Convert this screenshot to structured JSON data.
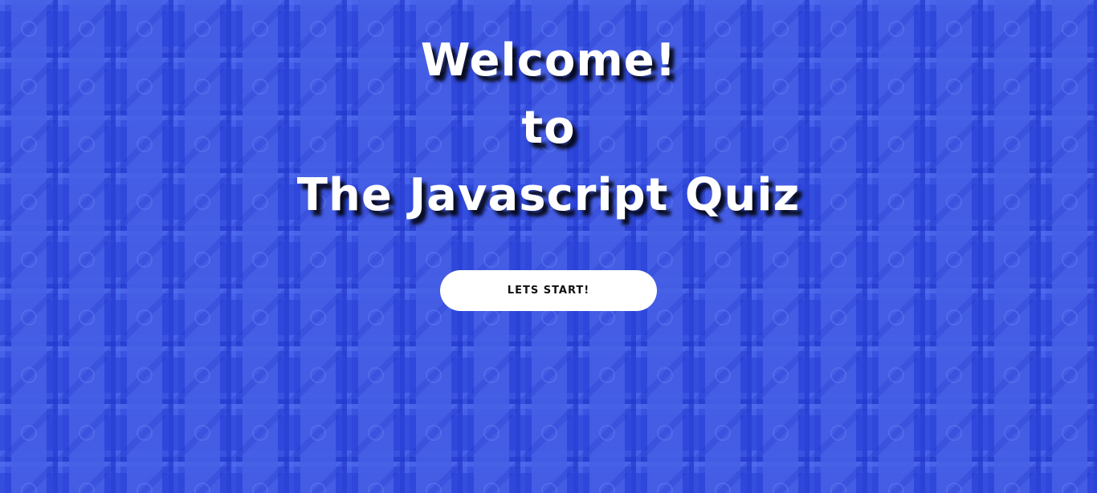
{
  "hero": {
    "line1": "Welcome!",
    "line2": "to",
    "line3": "The Javascript Quiz"
  },
  "actions": {
    "start_label": "LETS START!"
  },
  "colors": {
    "background": "#3a52e0",
    "title_text": "#ffffff",
    "button_bg": "#ffffff",
    "button_text": "#111111"
  }
}
